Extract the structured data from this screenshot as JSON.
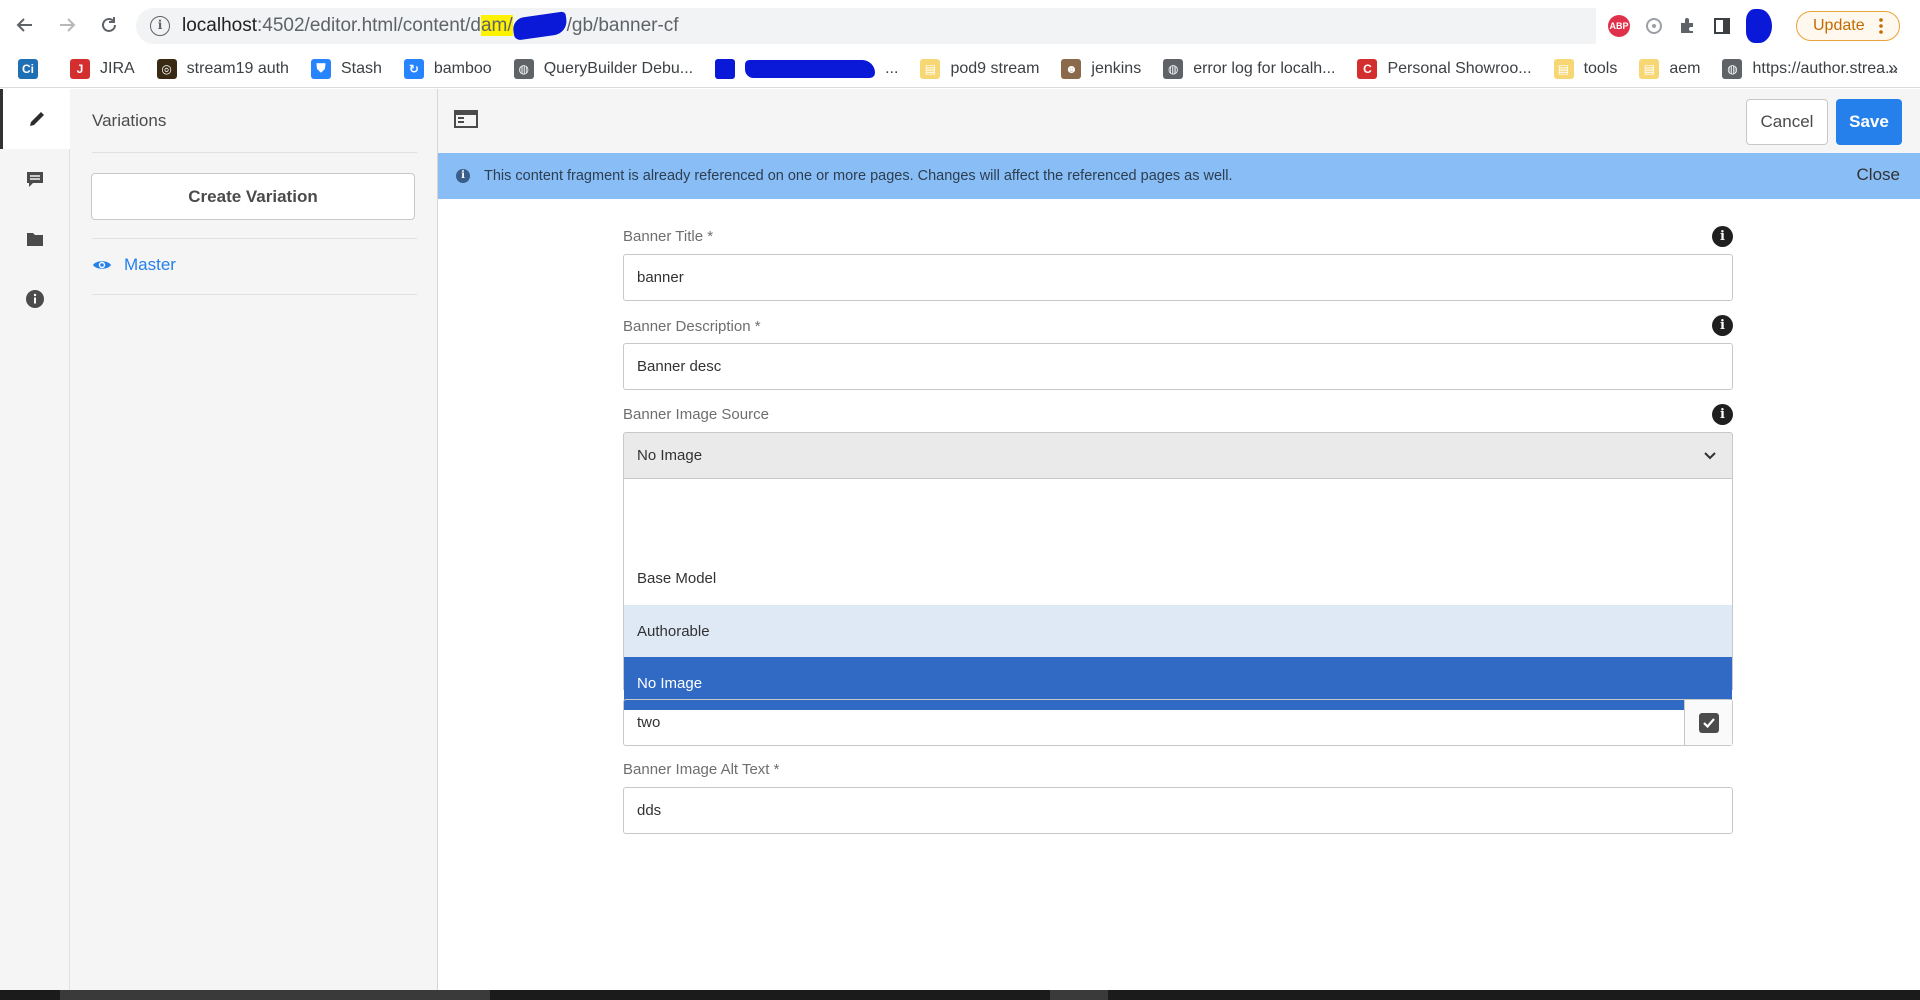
{
  "browser": {
    "url_host": "localhost",
    "url_path_pre": ":4502/editor.html/content/d",
    "url_highlight": "am/",
    "url_path_post": "/gb/banner-cf",
    "update_label": "Update"
  },
  "bookmarks": [
    {
      "label": "",
      "icon": "Ci",
      "color": "#1f6fb5"
    },
    {
      "label": "JIRA",
      "icon": "J",
      "color": "#d32f2f"
    },
    {
      "label": "stream19 auth",
      "icon": "◎",
      "color": "#3a2a14"
    },
    {
      "label": "Stash",
      "icon": "⛊",
      "color": "#2684ff"
    },
    {
      "label": "bamboo",
      "icon": "↻",
      "color": "#2684ff"
    },
    {
      "label": "QueryBuilder Debu...",
      "icon": "◍",
      "color": "#5f6368"
    },
    {
      "label": "...",
      "icon": "",
      "color": "#0a18d8"
    },
    {
      "label": "pod9 stream",
      "icon": "▤",
      "color": "#f7d774"
    },
    {
      "label": "jenkins",
      "icon": "☻",
      "color": "#8a6a4a"
    },
    {
      "label": "error log for localh...",
      "icon": "◍",
      "color": "#5f6368"
    },
    {
      "label": "Personal Showroo...",
      "icon": "C",
      "color": "#d32f2f"
    },
    {
      "label": "tools",
      "icon": "▤",
      "color": "#f7d774"
    },
    {
      "label": "aem",
      "icon": "▤",
      "color": "#f7d774"
    },
    {
      "label": "https://author.strea...",
      "icon": "◍",
      "color": "#5f6368"
    }
  ],
  "bookmarks_more": "»",
  "sidebar": {
    "title": "Variations",
    "create_button": "Create Variation",
    "variations": [
      "Master"
    ]
  },
  "toolbar": {
    "cancel_label": "Cancel",
    "save_label": "Save"
  },
  "alert": {
    "message": "This content fragment is already referenced on one or more pages. Changes will affect the referenced pages as well.",
    "close_label": "Close"
  },
  "form": {
    "banner_title": {
      "label": "Banner Title *",
      "value": "banner"
    },
    "banner_description": {
      "label": "Banner Description *",
      "value": "Banner desc"
    },
    "banner_image_source": {
      "label": "Banner Image Source",
      "value": "No Image",
      "options": [
        "",
        "Base Model",
        "Authorable",
        "No Image"
      ]
    },
    "tag_value": "two",
    "banner_alt_text": {
      "label": "Banner Image Alt Text *",
      "value": "dds"
    }
  }
}
